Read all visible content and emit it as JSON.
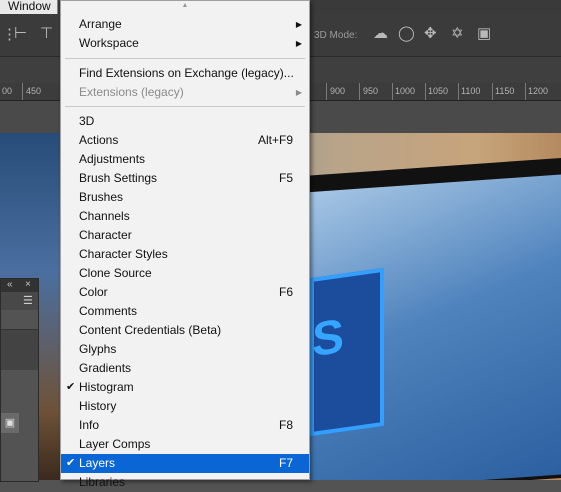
{
  "app": {
    "window_menu_label": "Window"
  },
  "optionsbar": {
    "mode_3d_label": "3D Mode:"
  },
  "ruler": {
    "left_labels": [
      "00",
      "450"
    ],
    "right_labels": [
      "900",
      "950",
      "1000",
      "1050",
      "1100",
      "1150",
      "1200"
    ]
  },
  "panel": {
    "collapse_label": "«",
    "close_label": "×"
  },
  "menu": {
    "group1": [
      {
        "label": "Arrange",
        "submenu": true
      },
      {
        "label": "Workspace",
        "submenu": true
      }
    ],
    "group2": [
      {
        "label": "Find Extensions on Exchange (legacy)...",
        "disabled": false
      },
      {
        "label": "Extensions (legacy)",
        "disabled": true,
        "submenu": true
      }
    ],
    "items": [
      {
        "label": "3D",
        "shortcut": ""
      },
      {
        "label": "Actions",
        "shortcut": "Alt+F9"
      },
      {
        "label": "Adjustments",
        "shortcut": ""
      },
      {
        "label": "Brush Settings",
        "shortcut": "F5"
      },
      {
        "label": "Brushes",
        "shortcut": ""
      },
      {
        "label": "Channels",
        "shortcut": ""
      },
      {
        "label": "Character",
        "shortcut": ""
      },
      {
        "label": "Character Styles",
        "shortcut": ""
      },
      {
        "label": "Clone Source",
        "shortcut": ""
      },
      {
        "label": "Color",
        "shortcut": "F6"
      },
      {
        "label": "Comments",
        "shortcut": ""
      },
      {
        "label": "Content Credentials (Beta)",
        "shortcut": ""
      },
      {
        "label": "Glyphs",
        "shortcut": ""
      },
      {
        "label": "Gradients",
        "shortcut": ""
      },
      {
        "label": "Histogram",
        "shortcut": "",
        "checked": true
      },
      {
        "label": "History",
        "shortcut": ""
      },
      {
        "label": "Info",
        "shortcut": "F8"
      },
      {
        "label": "Layer Comps",
        "shortcut": ""
      },
      {
        "label": "Layers",
        "shortcut": "F7",
        "checked": true,
        "highlighted": true
      },
      {
        "label": "Libraries",
        "shortcut": ""
      }
    ]
  },
  "colors": {
    "highlight": "#0a66d4",
    "menu_bg": "#f2f2f2"
  }
}
